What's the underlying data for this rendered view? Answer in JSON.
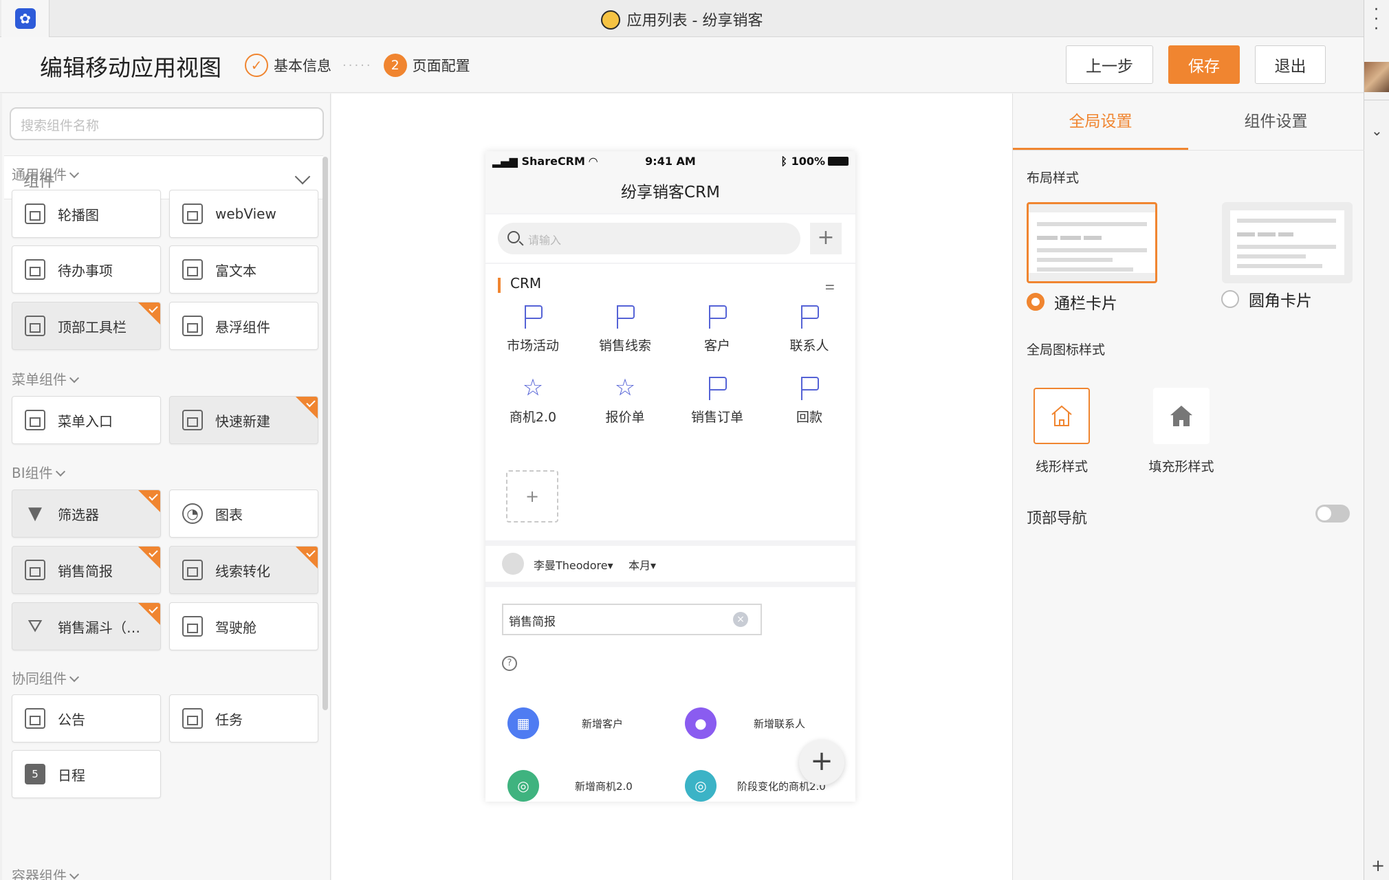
{
  "window": {
    "title": "应用列表 - 纷享销客"
  },
  "header": {
    "page_title": "编辑移动应用视图",
    "steps": [
      {
        "label": "基本信息",
        "state": "done"
      },
      {
        "number": "2",
        "label": "页面配置",
        "state": "current"
      }
    ],
    "buttons": {
      "prev": "上一步",
      "save": "保存",
      "exit": "退出"
    }
  },
  "left_panel": {
    "search_placeholder": "搜索组件名称",
    "component_select": "组件",
    "groups": {
      "general": "通用组件",
      "menu": "菜单组件",
      "bi": "BI组件",
      "collab": "协同组件",
      "container": "容器组件"
    },
    "items": {
      "carousel": "轮播图",
      "webview": "webView",
      "todo": "待办事项",
      "richtext": "富文本",
      "toolbar": "顶部工具栏",
      "floating": "悬浮组件",
      "menu_entry": "菜单入口",
      "quick_new": "快速新建",
      "filter": "筛选器",
      "chart": "图表",
      "sales_brief": "销售简报",
      "lead_conv": "线索转化",
      "funnel": "销售漏斗（…",
      "cockpit": "驾驶舱",
      "notice": "公告",
      "task": "任务",
      "schedule": "日程",
      "schedule_icon_text": "5"
    }
  },
  "phone": {
    "status": {
      "carrier": "ShareCRM",
      "time": "9:41 AM",
      "battery": "100%"
    },
    "title": "纷享销客CRM",
    "search_placeholder": "请输入",
    "crm_section": "CRM",
    "crm_items": [
      "市场活动",
      "销售线索",
      "客户",
      "联系人",
      "商机2.0",
      "报价单",
      "销售订单",
      "回款"
    ],
    "add_tile": "+",
    "user": "李曼Theodore▾",
    "period": "本月▾",
    "report_tag": "销售简报",
    "quick_actions": [
      "新增客户",
      "新增联系人",
      "新增商机2.0",
      "阶段变化的商机2.0"
    ]
  },
  "right_panel": {
    "tabs": {
      "global": "全局设置",
      "component": "组件设置"
    },
    "layout_title": "布局样式",
    "layout_options": {
      "full": "通栏卡片",
      "rounded": "圆角卡片"
    },
    "icon_title": "全局图标样式",
    "icon_options": {
      "line": "线形样式",
      "fill": "填充形样式"
    },
    "top_nav": "顶部导航"
  },
  "colors": {
    "accent": "#f08530",
    "icon_blue": "#5563d6"
  }
}
